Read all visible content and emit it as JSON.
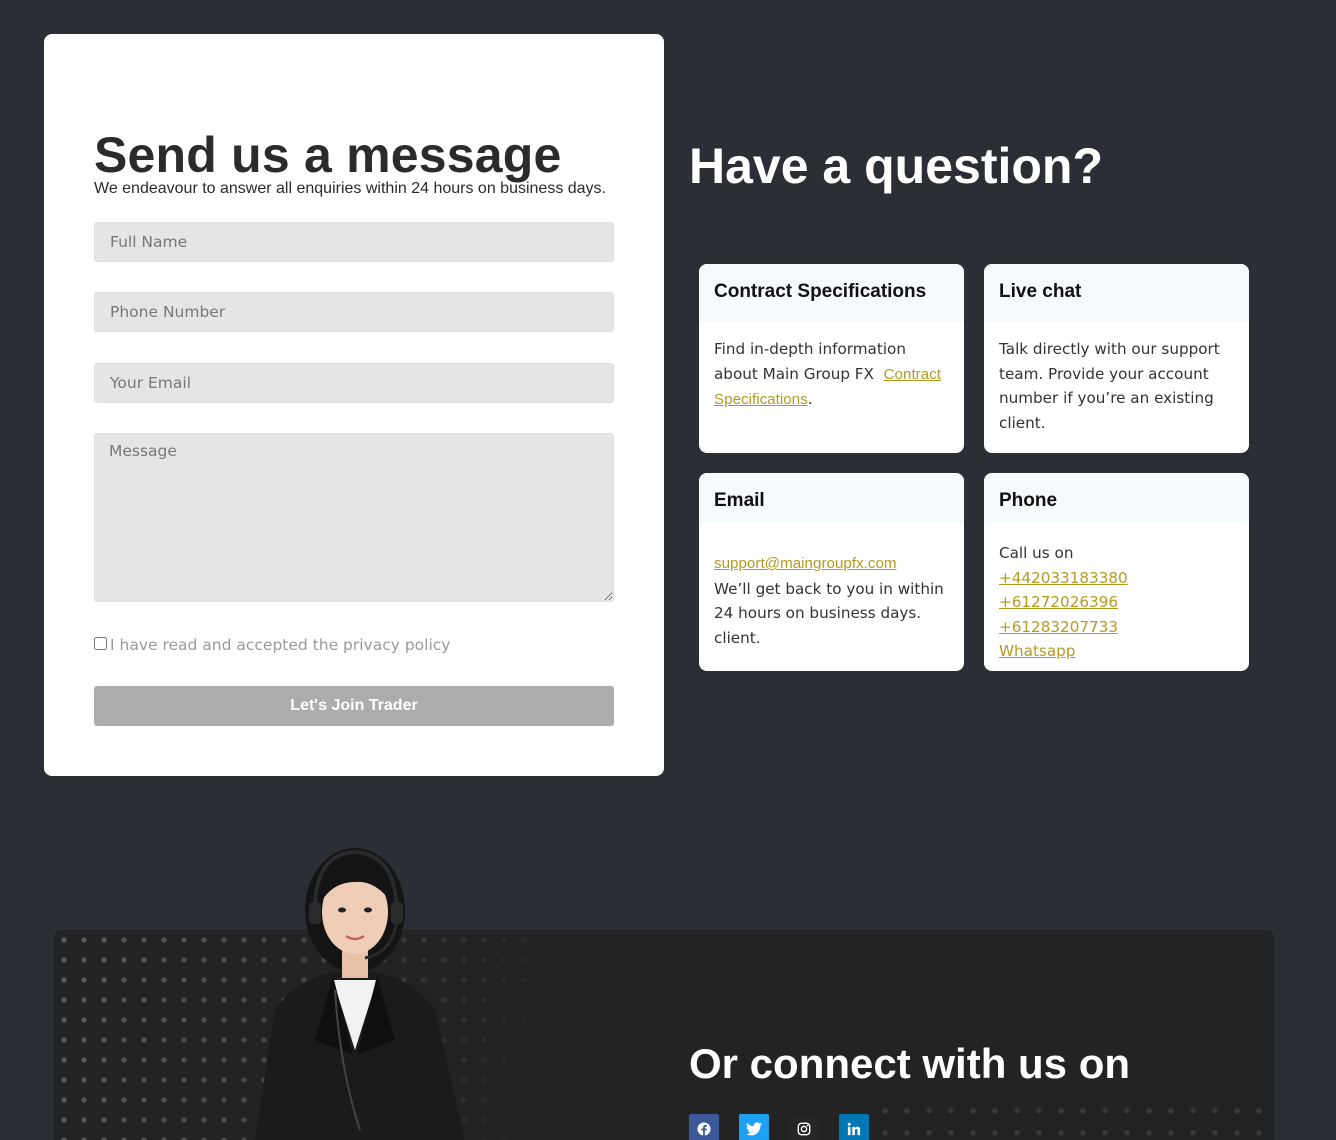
{
  "form": {
    "title": "Send us a message",
    "subtitle": "We endeavour to answer all enquiries within 24 hours on business days.",
    "full_name_placeholder": "Full Name",
    "phone_placeholder": "Phone Number",
    "email_placeholder": "Your Email",
    "message_placeholder": "Message",
    "privacy_label": "I have read and accepted the privacy policy",
    "privacy_checked": false,
    "submit_label": "Let's Join Trader"
  },
  "question": {
    "title": "Have a question?",
    "cards": {
      "contract": {
        "title": "Contract Specifications",
        "text": "Find in-depth information about Main Group FX",
        "link": "Contract Specifications",
        "suffix": "."
      },
      "chat": {
        "title": "Live chat",
        "text": "Talk directly with our support team. Provide your account number if you’re an existing client."
      },
      "email": {
        "title": "Email",
        "link": "support@maingroupfx.com",
        "text": "We’ll get back to you in within 24 hours on business days. client."
      },
      "phone": {
        "title": "Phone",
        "text": "Call us on",
        "numbers": [
          "+442033183380",
          "+61272026396",
          "+61283207733"
        ],
        "whatsapp": "Whatsapp"
      }
    }
  },
  "connect": {
    "title": "Or connect with us on",
    "socials": [
      "facebook-icon",
      "twitter-icon",
      "instagram-icon",
      "linkedin-icon"
    ]
  },
  "colors": {
    "background": "#2b2e35",
    "accent_gold": "#b69a1f",
    "card_head": "#f5fafd",
    "button": "#acacac"
  }
}
